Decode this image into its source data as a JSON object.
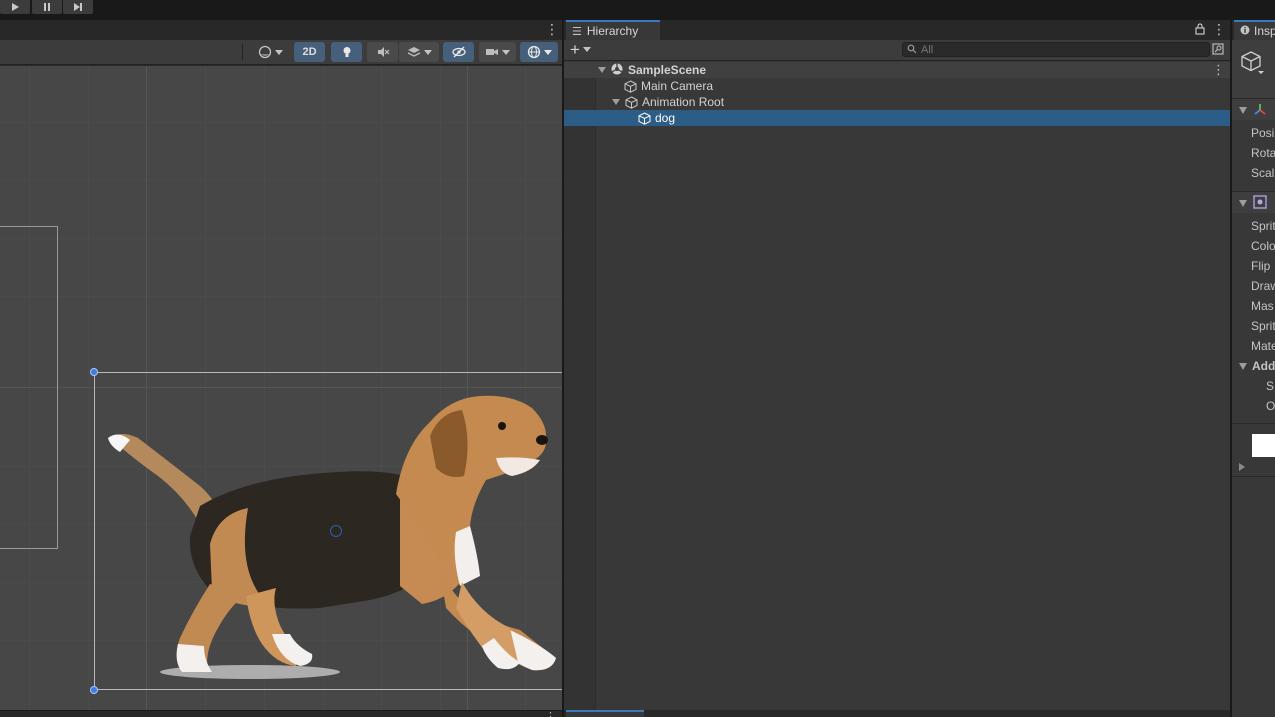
{
  "playbar": {
    "play_icon": "play-icon",
    "pause_icon": "pause-icon",
    "step_icon": "step-icon"
  },
  "scene": {
    "toolbar": {
      "draw_mode_icon": "shading-sphere-icon",
      "mode_2d_label": "2D",
      "lighting_icon": "light-bulb-icon",
      "audio_icon": "audio-mute-icon",
      "effects_icon": "layers-icon",
      "visibility_icon": "hidden-eye-icon",
      "camera_icon": "camera-icon",
      "gizmos_icon": "gizmo-globe-icon"
    },
    "object_name": "dog"
  },
  "hierarchy": {
    "tab_label": "Hierarchy",
    "add_icon": "plus-icon",
    "search_placeholder": "All",
    "tree": [
      {
        "label": "SampleScene",
        "type": "scene",
        "depth": 0,
        "expanded": true
      },
      {
        "label": "Main Camera",
        "type": "gameobject",
        "depth": 1
      },
      {
        "label": "Animation Root",
        "type": "gameobject",
        "depth": 1,
        "expanded": true
      },
      {
        "label": "dog",
        "type": "gameobject",
        "depth": 2,
        "selected": true
      }
    ]
  },
  "inspector": {
    "tab_label": "Insp",
    "transform_fields": [
      "Posi",
      "Rota",
      "Scal"
    ],
    "sprite_fields": [
      "Sprit",
      "Colo",
      "Flip",
      "Draw",
      "Mas",
      "Sprit",
      "Mate"
    ],
    "add_section": "Add",
    "add_subfields": [
      "S",
      "O"
    ]
  },
  "colors": {
    "selection": "#2c5d87",
    "accent": "#3a79bb",
    "toggle_on": "#46607c",
    "handle": "#3d7ce0"
  }
}
